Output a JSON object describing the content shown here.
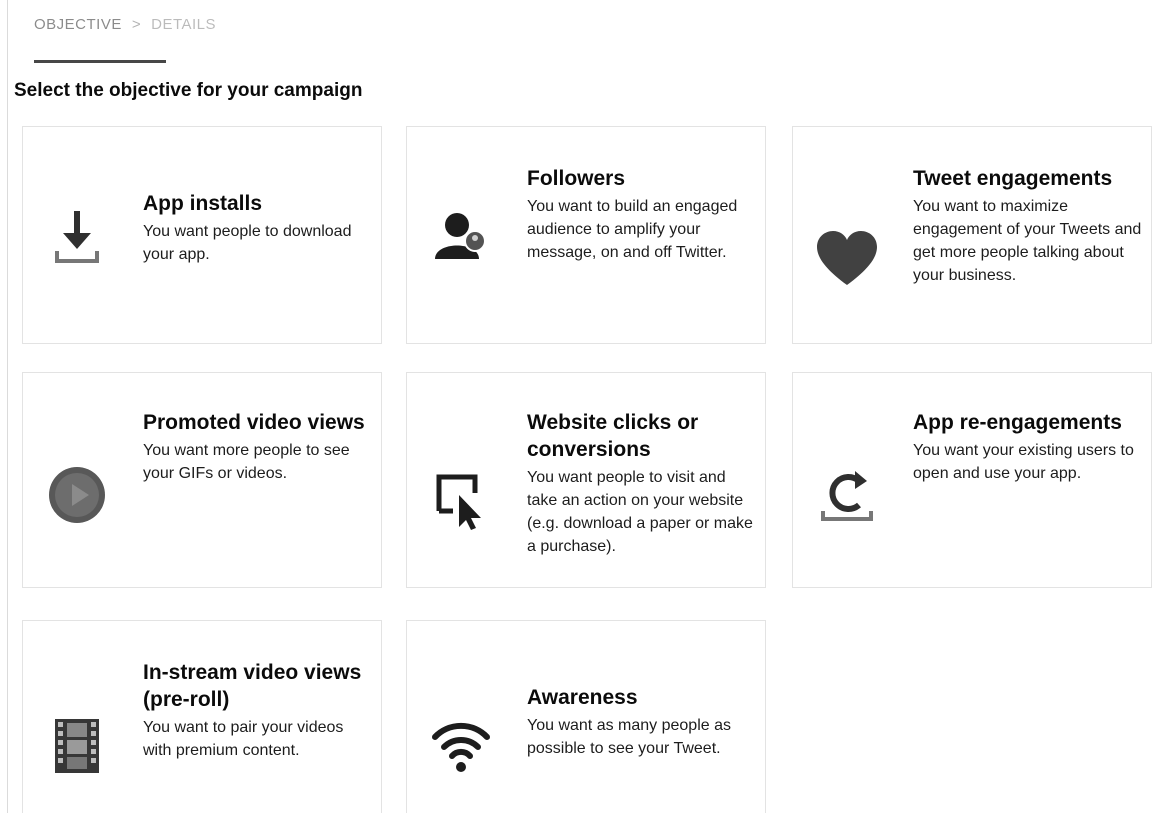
{
  "breadcrumb": {
    "steps": [
      "OBJECTIVE",
      "DETAILS"
    ],
    "separator": ">"
  },
  "title": "Select the objective for your campaign",
  "objectives": [
    {
      "title": "App installs",
      "description": "You want people to download your app.",
      "icon": "download-icon"
    },
    {
      "title": "Followers",
      "description": "You want to build an engaged audience to amplify your message, on and off Twitter.",
      "icon": "followers-icon"
    },
    {
      "title": "Tweet engagements",
      "description": "You want to maximize engagement of your Tweets and get more people talking about your business.",
      "icon": "heart-icon"
    },
    {
      "title": "Promoted video views",
      "description": "You want more people to see your GIFs or videos.",
      "icon": "video-play-icon"
    },
    {
      "title": "Website clicks or conversions",
      "description": "You want people to visit and take an action on your website (e.g. download a paper or make a purchase).",
      "icon": "cursor-click-icon"
    },
    {
      "title": "App re-engagements",
      "description": "You want your existing users to open and use your app.",
      "icon": "reengage-icon"
    },
    {
      "title": "In-stream video views (pre-roll)",
      "description": "You want to pair your videos with premium content.",
      "icon": "film-strip-icon"
    },
    {
      "title": "Awareness",
      "description": "You want as many people as possible to see your Tweet.",
      "icon": "wifi-signal-icon"
    }
  ]
}
